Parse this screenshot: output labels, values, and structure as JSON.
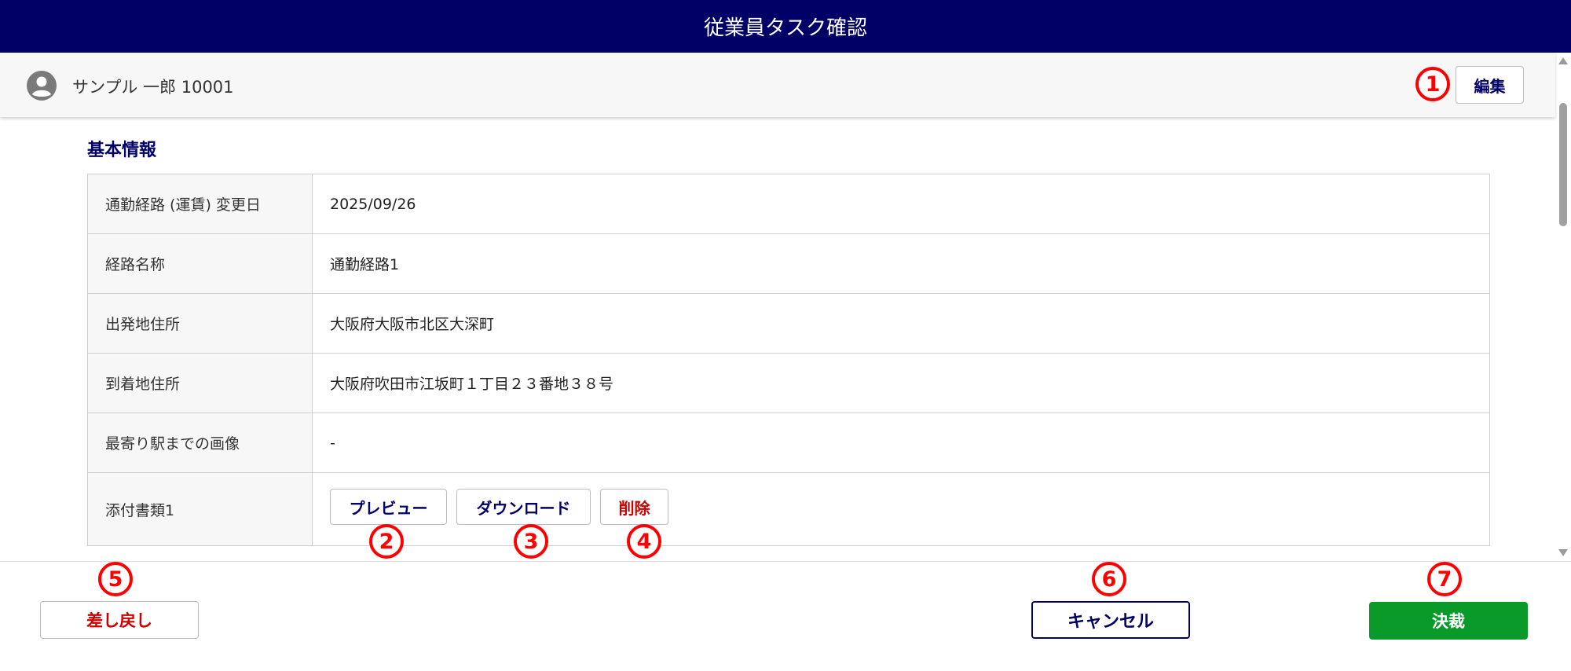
{
  "header": {
    "title": "従業員タスク確認"
  },
  "user": {
    "name": "サンプル 一郎 10001",
    "avatar_icon": "user-circle-icon"
  },
  "actions": {
    "edit_label": "編集"
  },
  "section": {
    "title": "基本情報"
  },
  "rows": [
    {
      "label": "通勤経路 (運賃) 変更日",
      "value": "2025/09/26"
    },
    {
      "label": "経路名称",
      "value": "通勤経路1"
    },
    {
      "label": "出発地住所",
      "value": "大阪府大阪市北区大深町"
    },
    {
      "label": "到着地住所",
      "value": "大阪府吹田市江坂町１丁目２３番地３８号"
    },
    {
      "label": "最寄り駅までの画像",
      "value": "-"
    },
    {
      "label": "添付書類1",
      "value": ""
    }
  ],
  "attachment_buttons": {
    "preview": "プレビュー",
    "download": "ダウンロード",
    "delete": "削除"
  },
  "footer": {
    "sendback_label": "差し戻し",
    "cancel_label": "キャンセル",
    "approve_label": "決裁"
  },
  "markers": [
    "1",
    "2",
    "3",
    "4",
    "5",
    "6",
    "7"
  ],
  "colors": {
    "header_bg": "#000066",
    "approve_bg": "#0a9a2a",
    "danger": "#cc0000",
    "marker": "#ff0000"
  }
}
